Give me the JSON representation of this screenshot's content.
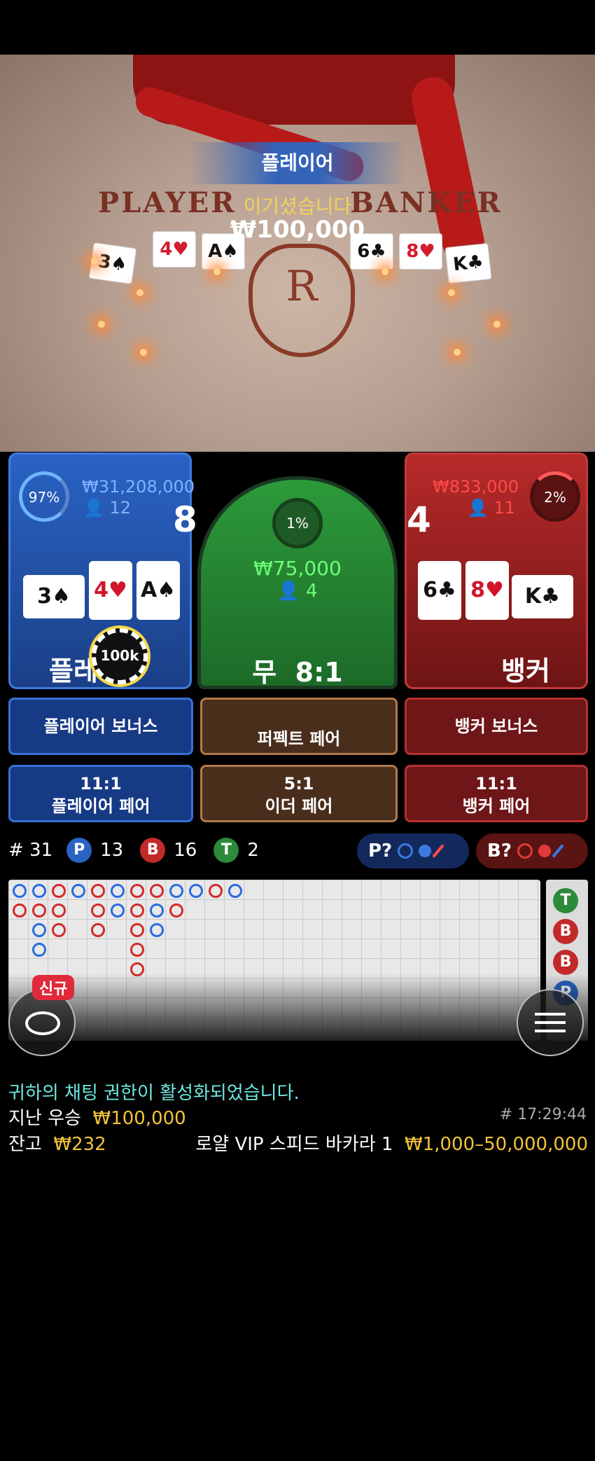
{
  "video": {
    "table_left_word": "PLAYER",
    "table_right_word": "BANKER",
    "emblem_letter": "R",
    "player_cards": [
      "3♠",
      "4♥",
      "A♠"
    ],
    "banker_cards": [
      "6♣",
      "8♥",
      "K♣"
    ],
    "result_label": "플레이어",
    "result_message": "이기셨습니다",
    "result_amount": "₩100,000"
  },
  "player": {
    "percent": "97%",
    "amount": "₩31,208,000",
    "count": "12",
    "total": "8",
    "label": "플레",
    "cards": [
      {
        "rank": "3",
        "suit": "♠",
        "color": "black",
        "side": true
      },
      {
        "rank": "4",
        "suit": "♥",
        "color": "red",
        "side": false
      },
      {
        "rank": "A",
        "suit": "♠",
        "color": "black",
        "side": false
      }
    ],
    "chip": "100k"
  },
  "tie": {
    "percent": "1%",
    "amount": "₩75,000",
    "count": "4",
    "label": "무",
    "payout": "8:1"
  },
  "banker": {
    "percent": "2%",
    "amount": "₩833,000",
    "count": "11",
    "total": "4",
    "label": "뱅커",
    "cards": [
      {
        "rank": "6",
        "suit": "♣",
        "color": "black",
        "side": false
      },
      {
        "rank": "8",
        "suit": "♥",
        "color": "red",
        "side": false
      },
      {
        "rank": "K",
        "suit": "♣",
        "color": "black",
        "side": true
      }
    ]
  },
  "side_bets": {
    "player_bonus": "플레이어 보너스",
    "perfect_pair": "퍼펙트 페어",
    "banker_bonus": "뱅커 보너스",
    "player_pair_odds": "11:1",
    "player_pair": "플레이어 페어",
    "either_pair_odds": "5:1",
    "either_pair": "이더 페어",
    "banker_pair_odds": "11:1",
    "banker_pair": "뱅커 페어"
  },
  "stats": {
    "rounds_label": "# 31",
    "p_letter": "P",
    "p_count": "13",
    "b_letter": "B",
    "b_count": "16",
    "t_letter": "T",
    "t_count": "2",
    "player_predict": "P?",
    "banker_predict": "B?"
  },
  "sidepanel_letters": [
    "T",
    "B",
    "B",
    "P"
  ],
  "new_badge": "신규",
  "chat_notice": "귀하의 채팅 권한이 활성화되었습니다.",
  "last_win_label": "지난 우승",
  "last_win_amount": "₩100,000",
  "round_id": "# 17:29:44",
  "balance_label": "잔고",
  "balance_amount": "₩232",
  "table_name": "로얄 VIP 스피드 바카라 1",
  "bet_limits": "₩1,000–50,000,000",
  "colors": {
    "player": "#2a63c4",
    "banker": "#b82a2a",
    "tie": "#2c9a3a",
    "gold": "#f2c33a"
  }
}
